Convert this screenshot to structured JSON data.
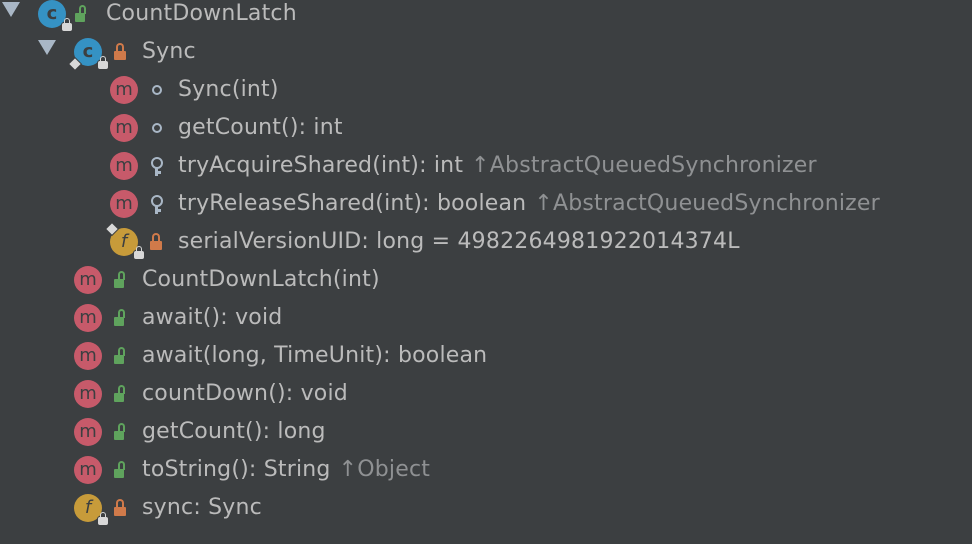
{
  "tree": {
    "root": {
      "label": "CountDownLatch",
      "kind_icon": "class-icon",
      "kind_letter": "c",
      "access": "public",
      "expanded": true
    },
    "sync_class": {
      "label": "Sync",
      "kind_icon": "class-icon",
      "kind_letter": "c",
      "access": "private",
      "expanded": true,
      "members": [
        {
          "kind_letter": "m",
          "access": "package",
          "signature": "Sync(int)",
          "inherited_from": ""
        },
        {
          "kind_letter": "m",
          "access": "package",
          "signature": "getCount(): int",
          "inherited_from": ""
        },
        {
          "kind_letter": "m",
          "access": "protected",
          "signature": "tryAcquireShared(int): int",
          "inherited_arrow": "↑",
          "inherited_from": "AbstractQueuedSynchronizer"
        },
        {
          "kind_letter": "m",
          "access": "protected",
          "signature": "tryReleaseShared(int): boolean",
          "inherited_arrow": "↑",
          "inherited_from": "AbstractQueuedSynchronizer"
        },
        {
          "kind_letter": "f",
          "access": "private",
          "signature": "serialVersionUID: long = 4982264981922014374L",
          "inherited_from": ""
        }
      ]
    },
    "members": [
      {
        "kind_letter": "m",
        "access": "public",
        "signature": "CountDownLatch(int)",
        "inherited_from": ""
      },
      {
        "kind_letter": "m",
        "access": "public",
        "signature": "await(): void",
        "inherited_from": ""
      },
      {
        "kind_letter": "m",
        "access": "public",
        "signature": "await(long, TimeUnit): boolean",
        "inherited_from": ""
      },
      {
        "kind_letter": "m",
        "access": "public",
        "signature": "countDown(): void",
        "inherited_from": ""
      },
      {
        "kind_letter": "m",
        "access": "public",
        "signature": "getCount(): long",
        "inherited_from": ""
      },
      {
        "kind_letter": "m",
        "access": "public",
        "signature": "toString(): String",
        "inherited_arrow": "↑",
        "inherited_from": "Object"
      },
      {
        "kind_letter": "f",
        "access": "private",
        "signature": "sync: Sync",
        "inherited_from": ""
      }
    ]
  },
  "colors": {
    "background": "#3c3f41",
    "text": "#bbbbbb",
    "inherited_text": "#8f9193",
    "class_icon": "#3592c4",
    "method_icon": "#c75a6a",
    "field_icon": "#c79b3a",
    "public_access": "#5fa35d",
    "private_access": "#d07a4a",
    "package_access": "#a9b7c6"
  }
}
